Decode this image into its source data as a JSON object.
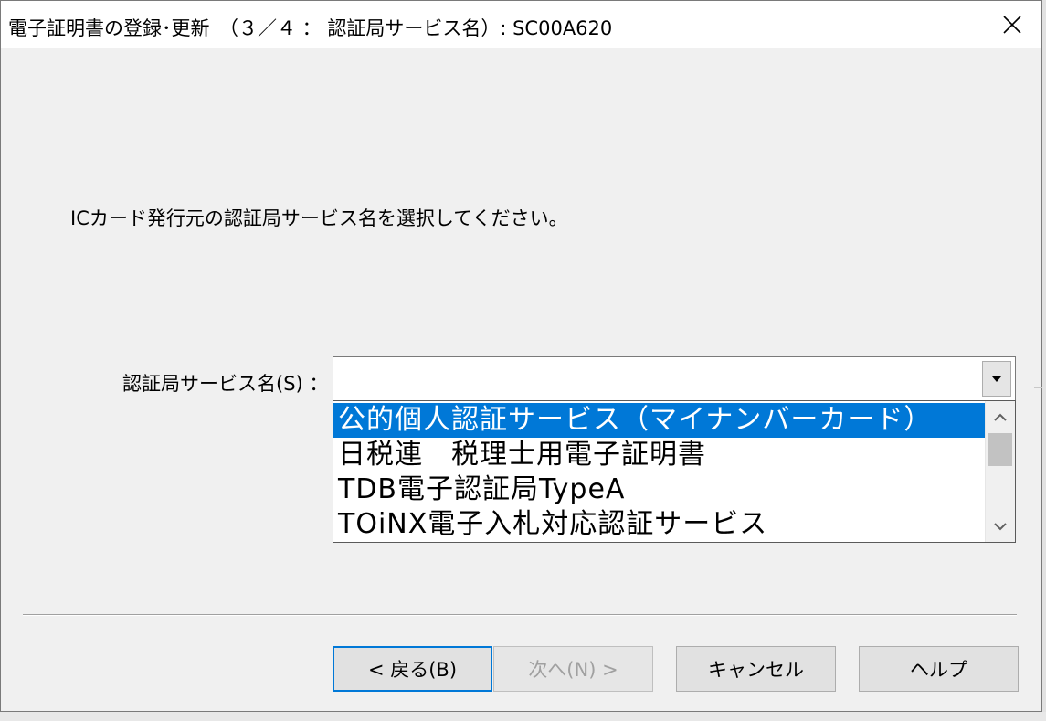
{
  "window": {
    "title": "電子証明書の登録･更新　（３／４ ： 認証局サービス名）: SC00A620",
    "close_icon": "close-icon"
  },
  "content": {
    "prompt": "ICカード発行元の認証局サービス名を選択してください。",
    "field_label": "認証局サービス名(S) ："
  },
  "combo": {
    "value": "",
    "arrow_icon": "chevron-down-icon",
    "options": [
      "公的個人認証サービス（マイナンバーカード）",
      "日税連　税理士用電子証明書",
      "TDB電子認証局TypeA",
      "TOiNX電子入札対応認証サービス"
    ],
    "selected_index": 0
  },
  "buttons": {
    "back": "< 戻る(B)",
    "next": "次へ(N) >",
    "cancel": "キャンセル",
    "help": "ヘルプ"
  },
  "colors": {
    "selection": "#0078d7",
    "default_button_border": "#0078d7",
    "disabled_text": "#a0a0a0"
  }
}
